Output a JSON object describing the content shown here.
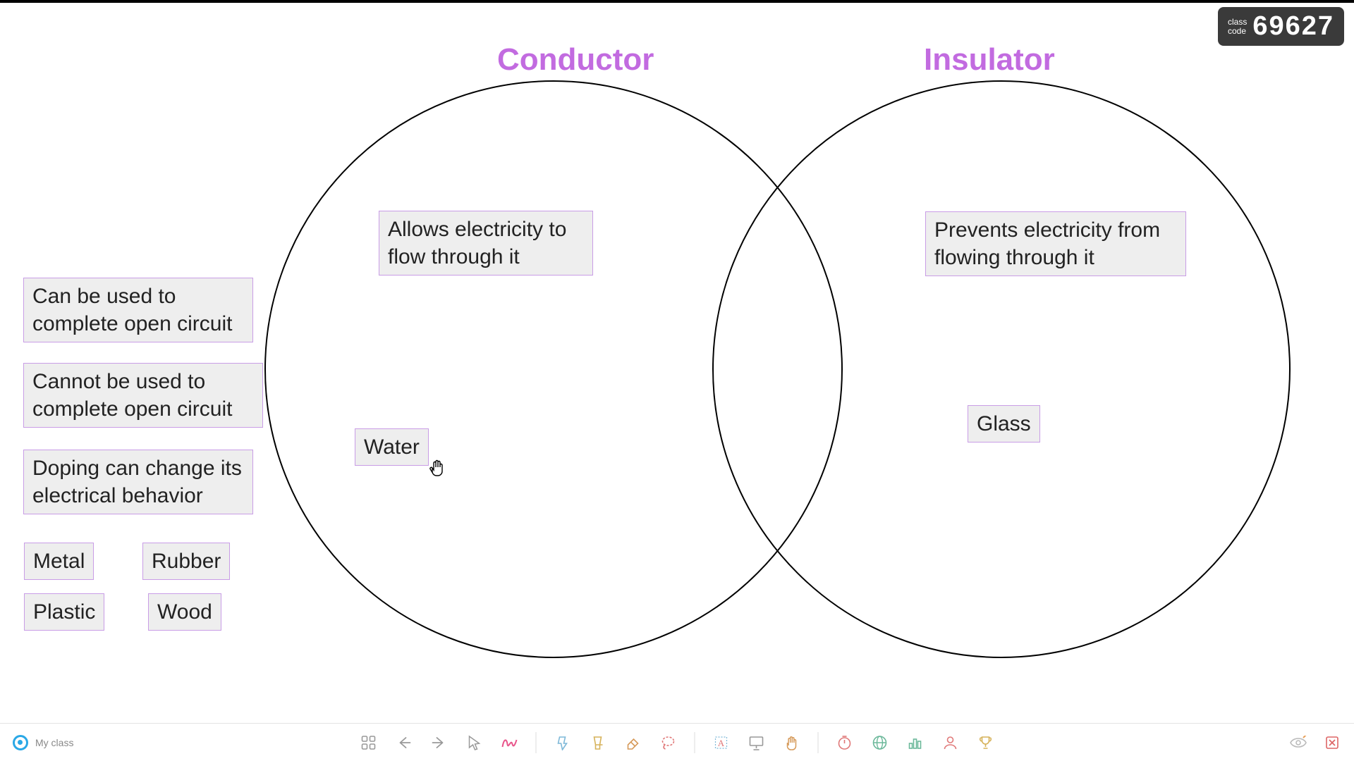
{
  "class_code": {
    "label_line1": "class",
    "label_line2": "code",
    "value": "69627"
  },
  "venn": {
    "left_title": "Conductor",
    "right_title": "Insulator"
  },
  "cards": {
    "allows": "Allows electricity to flow through it",
    "prevents": "Prevents electricity from flowing through it",
    "can_complete": "Can be used to complete open circuit",
    "cannot_complete": "Cannot be used to complete open circuit",
    "doping": "Doping can change its electrical behavior",
    "water": "Water",
    "glass": "Glass",
    "metal": "Metal",
    "rubber": "Rubber",
    "plastic": "Plastic",
    "wood": "Wood"
  },
  "bottombar": {
    "class_label": "My class"
  },
  "icons": {
    "grid": "grid-icon",
    "back": "arrow-left-icon",
    "forward": "arrow-right-icon",
    "pointer": "pointer-icon",
    "scribble": "scribble-icon",
    "highlighter1": "highlighter-icon",
    "highlighter2": "highlighter2-icon",
    "eraser": "eraser-icon",
    "lasso": "lasso-icon",
    "text": "text-box-icon",
    "screen": "presentation-icon",
    "hand": "hand-icon",
    "timer": "timer-icon",
    "globe": "globe-icon",
    "poll": "chart-icon",
    "user": "user-icon",
    "trophy": "trophy-icon",
    "eye": "eye-icon",
    "close": "close-panel-icon"
  }
}
